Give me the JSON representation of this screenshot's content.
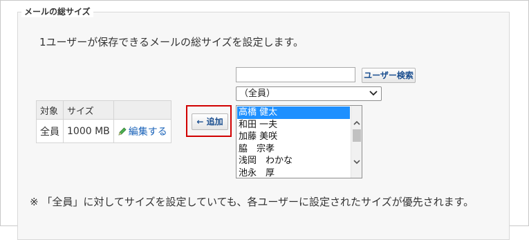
{
  "panel": {
    "legend": "メールの総サイズ",
    "description": "1ユーザーが保存できるメールの総サイズを設定します。"
  },
  "size_table": {
    "headers": [
      "対象",
      "サイズ",
      ""
    ],
    "rows": [
      {
        "target": "全員",
        "size": "1000 MB",
        "edit_label": "編集する"
      }
    ]
  },
  "add_button": {
    "label": "← 追加"
  },
  "user_search": {
    "input_value": "",
    "button_label": "ユーザー検索"
  },
  "group_select": {
    "selected": "（全員）"
  },
  "user_list": {
    "items": [
      "高橋 健太",
      "和田 一夫",
      "加藤 美咲",
      "脇　宗孝",
      "浅岡　わかな",
      "池永　厚"
    ],
    "selected_index": 0
  },
  "note": "※ 「全員」に対してサイズを設定していても、各ユーザーに設定されたサイズが優先されます。",
  "colors": {
    "accent_link": "#1a63b9",
    "selection": "#1e90ff",
    "highlight_frame": "#d10000",
    "panel_bg": "#f7f7f7"
  },
  "icons": {
    "edit": "pencil-icon",
    "select_arrow": "chevron-down-icon",
    "scroll_up": "chevron-up-icon",
    "scroll_down": "chevron-down-icon"
  }
}
